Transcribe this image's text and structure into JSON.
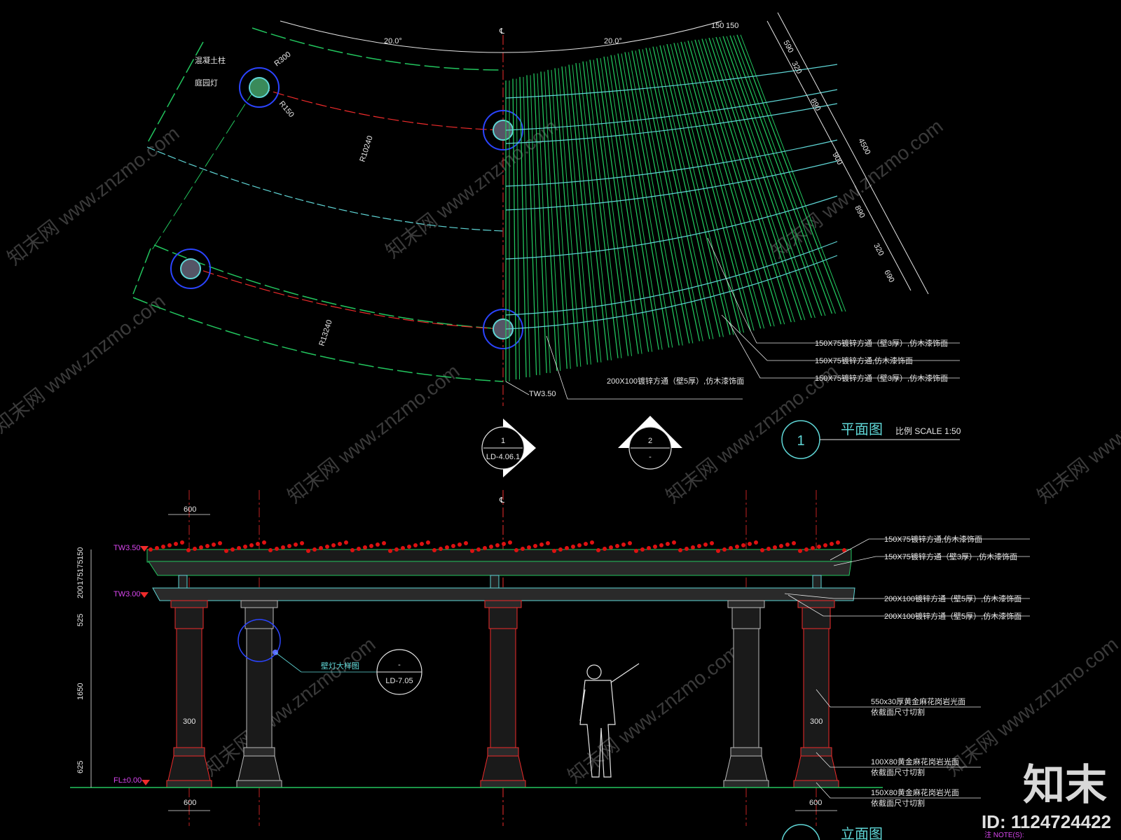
{
  "plan": {
    "angle_left": "20.0°",
    "angle_right": "20.0°",
    "centerline": "℄",
    "top_dims": [
      "150",
      "150"
    ],
    "side_dims": [
      "590",
      "320",
      "890",
      "900",
      "890",
      "320",
      "690"
    ],
    "overall_dim": "4500",
    "radius_outer": "R300",
    "radius_inner": "R150",
    "radius_1": "R10240",
    "radius_2": "R13240",
    "label_concrete": "混凝土柱",
    "label_lamp": "庭园灯",
    "member_1": "150X75镀锌方通（壁3厚）,仿木漆饰面",
    "member_2": "150X75镀锌方通,仿木漆饰面",
    "member_3": "150X75镀锌方通（壁3厚）,仿木漆饰面",
    "member_4": "200X100镀锌方通（壁5厚）,仿木漆饰面",
    "tw_plan": "TW3.50",
    "title": "平面图",
    "scale": "比例 SCALE 1:50",
    "title_no": "1"
  },
  "section_markers": [
    {
      "num": "1",
      "ref": "LD-4.06.1"
    },
    {
      "num": "2",
      "ref": "-"
    }
  ],
  "elevation": {
    "centerline": "℄",
    "dim_600_top": "600",
    "dim_600_bl": "600",
    "dim_600_br": "600",
    "dim_300_l": "300",
    "dim_300_r": "300",
    "tw1": "TW3.50",
    "tw2": "TW3.00",
    "fl": "FL±0.00",
    "vert_dims": [
      "150",
      "175",
      "175",
      "200",
      "525",
      "1650",
      "625"
    ],
    "lamp_label": "壁灯大样图",
    "lamp_ref_num": "-",
    "lamp_ref": "LD-7.05",
    "notes": [
      "150X75镀锌方通,仿木漆饰面",
      "150X75镀锌方通（壁3厚）,仿木漆饰面",
      "200X100镀锌方通（壁5厚）,仿木漆饰面",
      "200X100镀锌方通（壁5厚）,仿木漆饰面"
    ],
    "note_granite_1": "550x30厚黄金麻花岗岩光面",
    "note_granite_1b": "依截面尺寸切割",
    "note_granite_2": "100X80黄金麻花岗岩光面",
    "note_granite_2b": "依截面尺寸切割",
    "note_granite_3": "150X80黄金麻花岗岩光面",
    "note_granite_3b": "依截面尺寸切割",
    "title": "立面图",
    "note_heading": "注 NOTE(S):"
  },
  "watermark": "知末网 www.znzmo.com",
  "brand": "知末",
  "image_id": "ID: 1124724422",
  "colors": {
    "green": "#22c55e",
    "red": "#ef2b2b",
    "cyan": "#5fd6d6",
    "blue": "#2b44ff",
    "white": "#e6e6e6"
  }
}
